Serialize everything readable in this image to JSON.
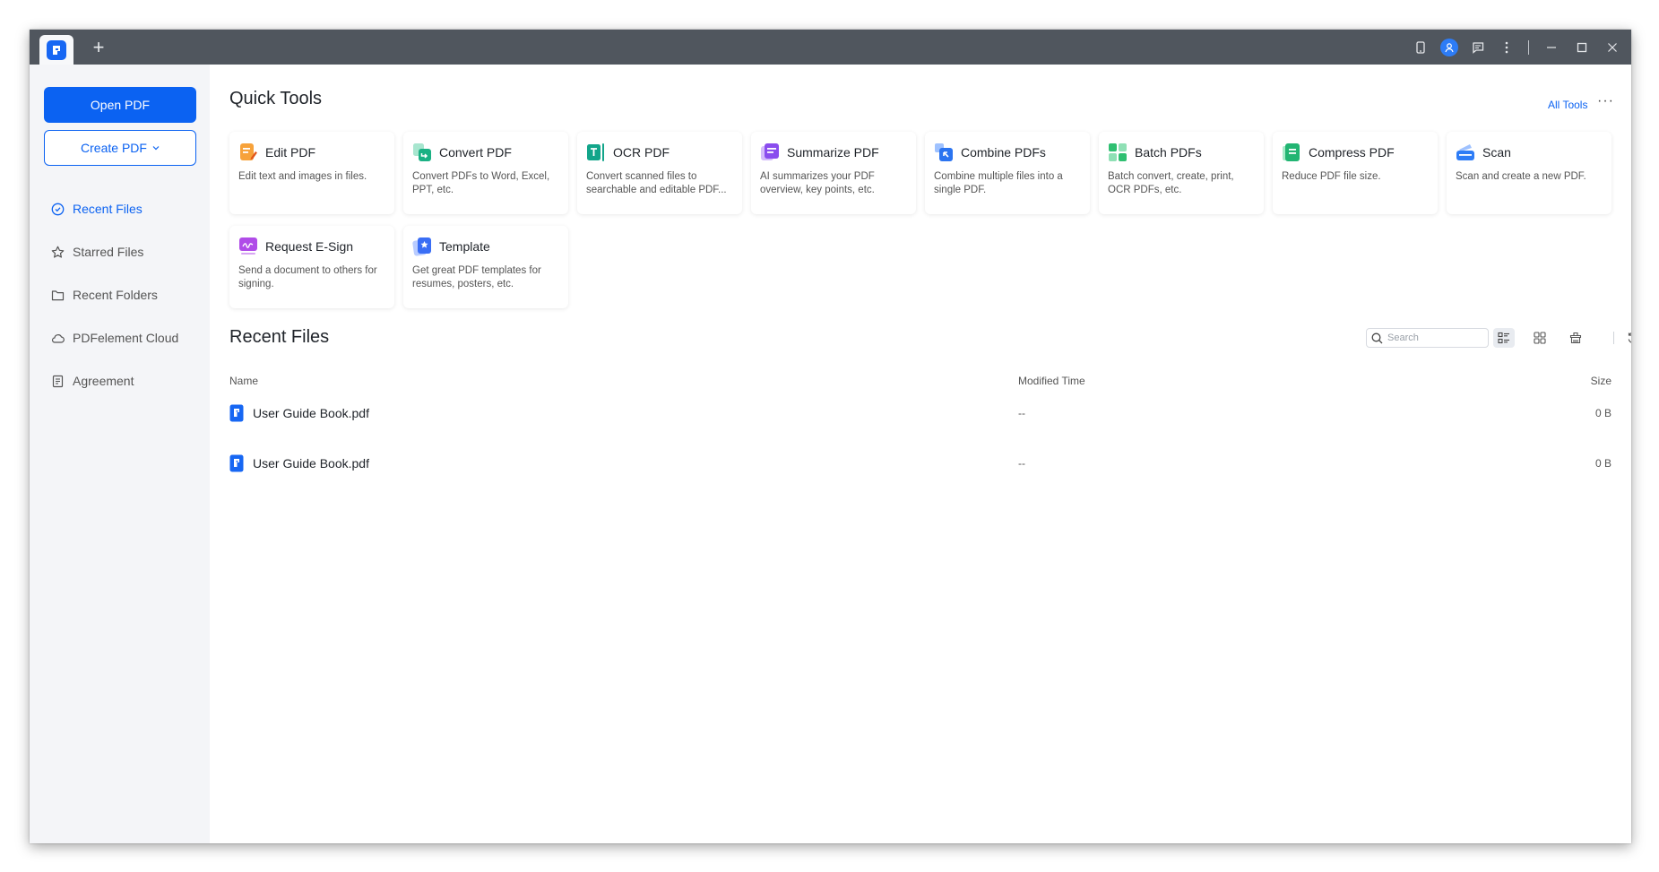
{
  "titlebar": {
    "icons": [
      "home-tab-logo",
      "new-tab-plus-icon",
      "device-icon",
      "account-avatar-icon",
      "feedback-icon",
      "more-vertical-icon",
      "minimize-icon",
      "maximize-icon",
      "close-icon"
    ]
  },
  "sidebar": {
    "open_pdf": "Open PDF",
    "create_pdf": "Create PDF",
    "items": [
      {
        "label": "Recent Files",
        "icon": "clock-icon",
        "active": true
      },
      {
        "label": "Starred Files",
        "icon": "star-icon",
        "active": false
      },
      {
        "label": "Recent Folders",
        "icon": "folder-icon",
        "active": false
      },
      {
        "label": "PDFelement Cloud",
        "icon": "cloud-icon",
        "active": false
      },
      {
        "label": "Agreement",
        "icon": "document-icon",
        "active": false
      }
    ]
  },
  "quick_tools": {
    "title": "Quick Tools",
    "all_tools": "All Tools",
    "more": "···",
    "tools": [
      {
        "name": "Edit PDF",
        "desc": "Edit text and images in files.",
        "color": "#f28c1b"
      },
      {
        "name": "Convert PDF",
        "desc": "Convert PDFs to Word, Excel, PPT, etc.",
        "color": "#1bb184"
      },
      {
        "name": "OCR PDF",
        "desc": "Convert scanned files to searchable and editable PDF...",
        "color": "#12a58a"
      },
      {
        "name": "Summarize PDF",
        "desc": "AI summarizes your PDF overview, key points, etc.",
        "color": "#8a4dee"
      },
      {
        "name": "Combine PDFs",
        "desc": "Combine multiple files into a single PDF.",
        "color": "#2b74f0"
      },
      {
        "name": "Batch PDFs",
        "desc": "Batch convert, create, print, OCR PDFs, etc.",
        "color": "#2fbf71"
      },
      {
        "name": "Compress PDF",
        "desc": "Reduce PDF file size.",
        "color": "#22b573"
      },
      {
        "name": "Scan",
        "desc": "Scan and create a new PDF.",
        "color": "#2d7cf6"
      },
      {
        "name": "Request E-Sign",
        "desc": "Send a document to others for signing.",
        "color": "#b04ce8"
      },
      {
        "name": "Template",
        "desc": "Get great PDF templates for resumes, posters, etc.",
        "color": "#3a6ef5"
      }
    ]
  },
  "recent_files": {
    "title": "Recent Files",
    "search_placeholder": "Search",
    "columns": {
      "name": "Name",
      "modified": "Modified Time",
      "size": "Size"
    },
    "rows": [
      {
        "name": "User Guide Book.pdf",
        "modified": "--",
        "size": "0 B"
      },
      {
        "name": "User Guide Book.pdf",
        "modified": "--",
        "size": "0 B"
      }
    ]
  }
}
